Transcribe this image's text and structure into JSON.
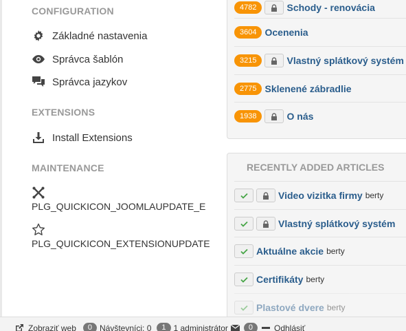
{
  "sidebar": {
    "configuration_title": "CONFIGURATION",
    "config_items": [
      {
        "label": "Základné nastavenia",
        "icon": "gear-icon"
      },
      {
        "label": "Správca šablón",
        "icon": "eye-icon"
      },
      {
        "label": "Správca jazykov",
        "icon": "comments-icon"
      }
    ],
    "extensions_title": "EXTENSIONS",
    "install_label": "Install Extensions",
    "maintenance_title": "MAINTENANCE",
    "joomla_update_label": "PLG_QUICKICON_JOOMLAUPDATE_E",
    "extension_update_label": "PLG_QUICKICON_EXTENSIONUPDATE"
  },
  "popular": {
    "rows": [
      {
        "hits": "4782",
        "locked": true,
        "title": "Schody - renovácia"
      },
      {
        "hits": "3604",
        "locked": false,
        "title": "Ocenenia"
      },
      {
        "hits": "3215",
        "locked": true,
        "title": "Vlastný splátkový systém"
      },
      {
        "hits": "2775",
        "locked": false,
        "title": "Sklenené zábradlie"
      },
      {
        "hits": "1938",
        "locked": true,
        "title": "O nás"
      }
    ]
  },
  "recent": {
    "title": "RECENTLY ADDED ARTICLES",
    "rows": [
      {
        "title": "Video vizitka firmy",
        "author": "berty",
        "locked": true
      },
      {
        "title": "Vlastný splátkový systém",
        "author": "",
        "locked": true
      },
      {
        "title": "Aktuálne akcie",
        "author": "berty",
        "locked": false
      },
      {
        "title": "Certifikáty",
        "author": "berty",
        "locked": false
      },
      {
        "title": "Plastové dvere",
        "author": "berty",
        "locked": false
      }
    ]
  },
  "status": {
    "view_site": "Zobraziť web",
    "visitors_count": "0",
    "visitors_label": "Návštevníci: 0",
    "admins_count": "1",
    "admins_label": "1 administrátor",
    "messages_count": "0",
    "logout_label": "Odhlásiť"
  },
  "colors": {
    "hits_badge": "#f89406",
    "article_link": "#2a5d8c",
    "section_title": "#999999"
  }
}
